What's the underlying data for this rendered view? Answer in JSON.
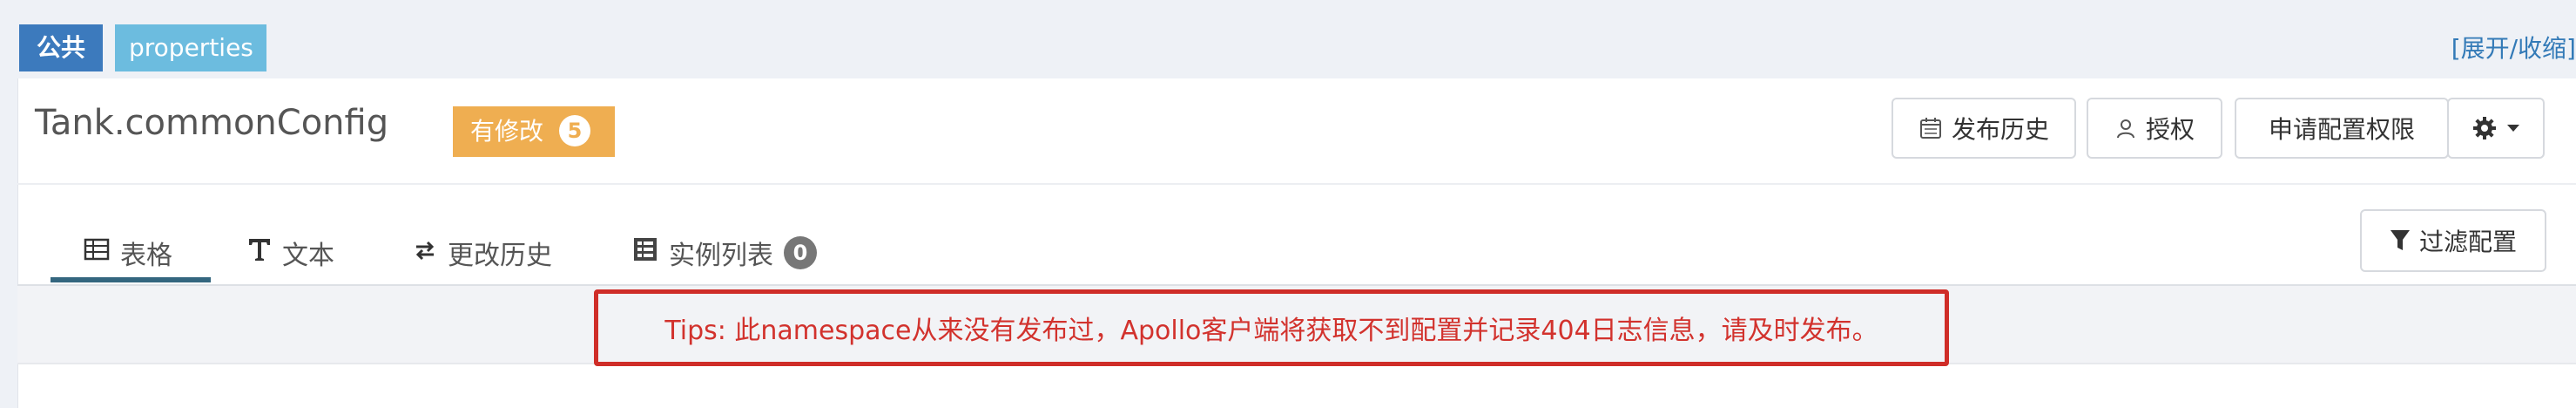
{
  "header": {
    "tag_public": "公共",
    "tag_properties": "properties",
    "toggle_label": "[展开/收缩]"
  },
  "namespace": {
    "title": "Tank.commonConfig",
    "modified_label": "有修改",
    "modified_count": "5"
  },
  "actions": {
    "release_history": "发布历史",
    "authorize": "授权",
    "request_permission": "申请配置权限",
    "settings_icon": "gear-icon"
  },
  "tabs": [
    {
      "label": "表格",
      "icon": "table-icon",
      "active": true
    },
    {
      "label": "文本",
      "icon": "text-icon"
    },
    {
      "label": "更改历史",
      "icon": "history-icon"
    },
    {
      "label": "实例列表",
      "icon": "instance-list-icon",
      "count": "0"
    }
  ],
  "filter": {
    "label": "过滤配置"
  },
  "tips": "Tips: 此namespace从来没有发布过，Apollo客户端将获取不到配置并记录404日志信息，请及时发布。",
  "colors": {
    "primary": "#3c7abd",
    "info": "#6cbcdf",
    "warning": "#efae51",
    "danger": "#d2322d"
  }
}
